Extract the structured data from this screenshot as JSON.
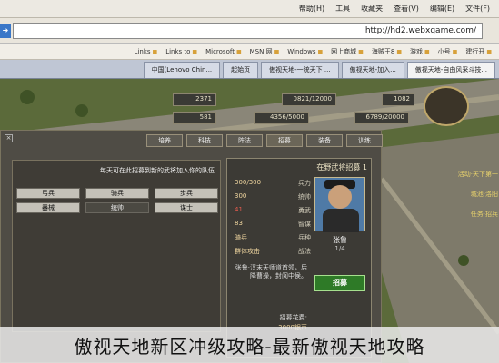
{
  "browser": {
    "menu": [
      "帮助(H)",
      "工具",
      "收藏夹",
      "查看(V)",
      "编辑(E)",
      "文件(F)"
    ],
    "address": "http://hd2.webxgame.com/",
    "bookmarks": [
      "Links",
      "Links to",
      "Microsoft",
      "MSN 网",
      "Windows",
      "网上商城",
      "海贼王8",
      "游戏",
      "小号",
      "建行开"
    ],
    "tabs": [
      {
        "label": "中国(Lenovo Chin...",
        "active": false
      },
      {
        "label": "起始页",
        "active": false
      },
      {
        "label": "傲视天地-一统天下 ...",
        "active": false
      },
      {
        "label": "傲视天地-加入...",
        "active": false
      },
      {
        "label": "傲视天地-自由风采斗技...",
        "active": true
      }
    ]
  },
  "game": {
    "top_stats": [
      "1082",
      "0821/12000",
      "2371",
      "6789/20000",
      "4356/5000",
      "581"
    ],
    "panel_tabs": [
      {
        "label": "训练",
        "active": false
      },
      {
        "label": "装备",
        "active": false
      },
      {
        "label": "招募",
        "active": true
      },
      {
        "label": "阵法",
        "active": false
      },
      {
        "label": "科技",
        "active": false
      },
      {
        "label": "培养",
        "active": false
      }
    ],
    "close_label": "×",
    "info_line": "每天可在此招募到新的武将加入你的队伍",
    "options": [
      {
        "label": "步兵",
        "dark": false
      },
      {
        "label": "骑兵",
        "dark": false
      },
      {
        "label": "弓兵",
        "dark": false
      },
      {
        "label": "谋士",
        "dark": false
      },
      {
        "label": "统帅",
        "dark": true
      },
      {
        "label": "器械",
        "dark": false
      }
    ],
    "card": {
      "title": "在野武将招募 1",
      "hero_name": "张鲁",
      "hero_level": "1/4",
      "stats": [
        {
          "label": "兵力",
          "value": "300/300",
          "red": false
        },
        {
          "label": "统帅",
          "value": "300",
          "red": false
        },
        {
          "label": "勇武",
          "value": "41",
          "red": true
        },
        {
          "label": "智谋",
          "value": "83",
          "red": false
        },
        {
          "label": "兵种",
          "value": "骑兵",
          "red": false
        },
        {
          "label": "战法",
          "value": "群体攻击",
          "red": false
        }
      ],
      "bottom_text": "张鲁·汉末天师道首领，后降曹操，封阆中侯。",
      "cost_label": "招募花费:",
      "cost_value": "3000银币",
      "recruit_label": "招募"
    },
    "side_notes": [
      "活动·天下第一",
      "城池·洛阳",
      "任务·招兵"
    ]
  },
  "caption": "傲视天地新区冲级攻略-最新傲视天地攻略"
}
